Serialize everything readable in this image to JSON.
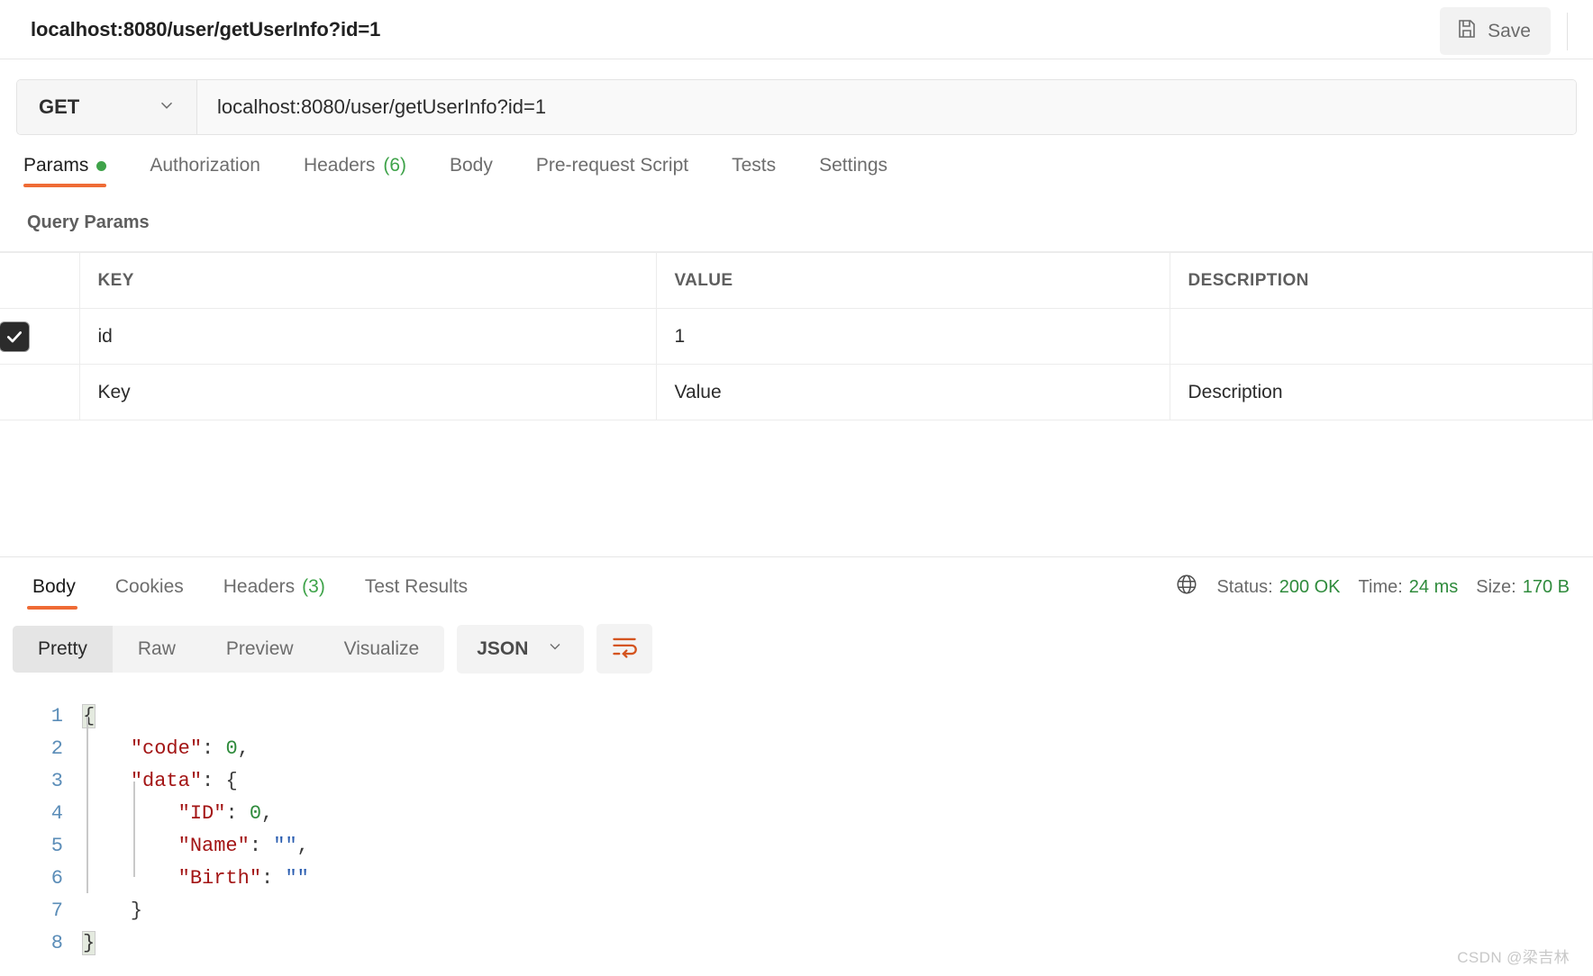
{
  "header": {
    "request_title": "localhost:8080/user/getUserInfo?id=1",
    "save_label": "Save",
    "save_icon": "floppy-disk-icon"
  },
  "url_bar": {
    "method": "GET",
    "method_caret_icon": "chevron-down-icon",
    "url": "localhost:8080/user/getUserInfo?id=1"
  },
  "request_tabs": [
    {
      "label": "Params",
      "badge": "",
      "active": true,
      "dot": true
    },
    {
      "label": "Authorization",
      "badge": "",
      "active": false,
      "dot": false
    },
    {
      "label": "Headers",
      "badge": "(6)",
      "active": false,
      "dot": false
    },
    {
      "label": "Body",
      "badge": "",
      "active": false,
      "dot": false
    },
    {
      "label": "Pre-request Script",
      "badge": "",
      "active": false,
      "dot": false
    },
    {
      "label": "Tests",
      "badge": "",
      "active": false,
      "dot": false
    },
    {
      "label": "Settings",
      "badge": "",
      "active": false,
      "dot": false
    }
  ],
  "query_params": {
    "section_title": "Query Params",
    "columns": [
      "KEY",
      "VALUE",
      "DESCRIPTION"
    ],
    "rows": [
      {
        "checked": true,
        "key": "id",
        "value": "1",
        "description": ""
      }
    ],
    "placeholder_row": {
      "key": "Key",
      "value": "Value",
      "description": "Description"
    }
  },
  "response": {
    "tabs": [
      {
        "label": "Body",
        "badge": "",
        "active": true
      },
      {
        "label": "Cookies",
        "badge": "",
        "active": false
      },
      {
        "label": "Headers",
        "badge": "(3)",
        "active": false
      },
      {
        "label": "Test Results",
        "badge": "",
        "active": false
      }
    ],
    "globe_icon": "globe-icon",
    "status_label": "Status:",
    "status_value": "200 OK",
    "time_label": "Time:",
    "time_value": "24 ms",
    "size_label": "Size:",
    "size_value": "170 B",
    "view_modes": [
      {
        "label": "Pretty",
        "active": true
      },
      {
        "label": "Raw",
        "active": false
      },
      {
        "label": "Preview",
        "active": false
      },
      {
        "label": "Visualize",
        "active": false
      }
    ],
    "format": "JSON",
    "format_caret_icon": "chevron-down-icon",
    "wrap_icon": "word-wrap-icon",
    "body_lines": [
      {
        "num": "1",
        "text": "{"
      },
      {
        "num": "2",
        "text": "    \"code\": 0,"
      },
      {
        "num": "3",
        "text": "    \"data\": {"
      },
      {
        "num": "4",
        "text": "        \"ID\": 0,"
      },
      {
        "num": "5",
        "text": "        \"Name\": \"\","
      },
      {
        "num": "6",
        "text": "        \"Birth\": \"\""
      },
      {
        "num": "7",
        "text": "    }"
      },
      {
        "num": "8",
        "text": "}"
      }
    ],
    "body_json": {
      "code": 0,
      "data": {
        "ID": 0,
        "Name": "",
        "Birth": ""
      }
    }
  },
  "colors": {
    "accent_orange": "#ef6b35",
    "status_green": "#2f8b3c",
    "key_red": "#a31515",
    "string_blue": "#2a5db0",
    "gutter_blue": "#5b8db8"
  },
  "watermark": "CSDN @梁吉林"
}
